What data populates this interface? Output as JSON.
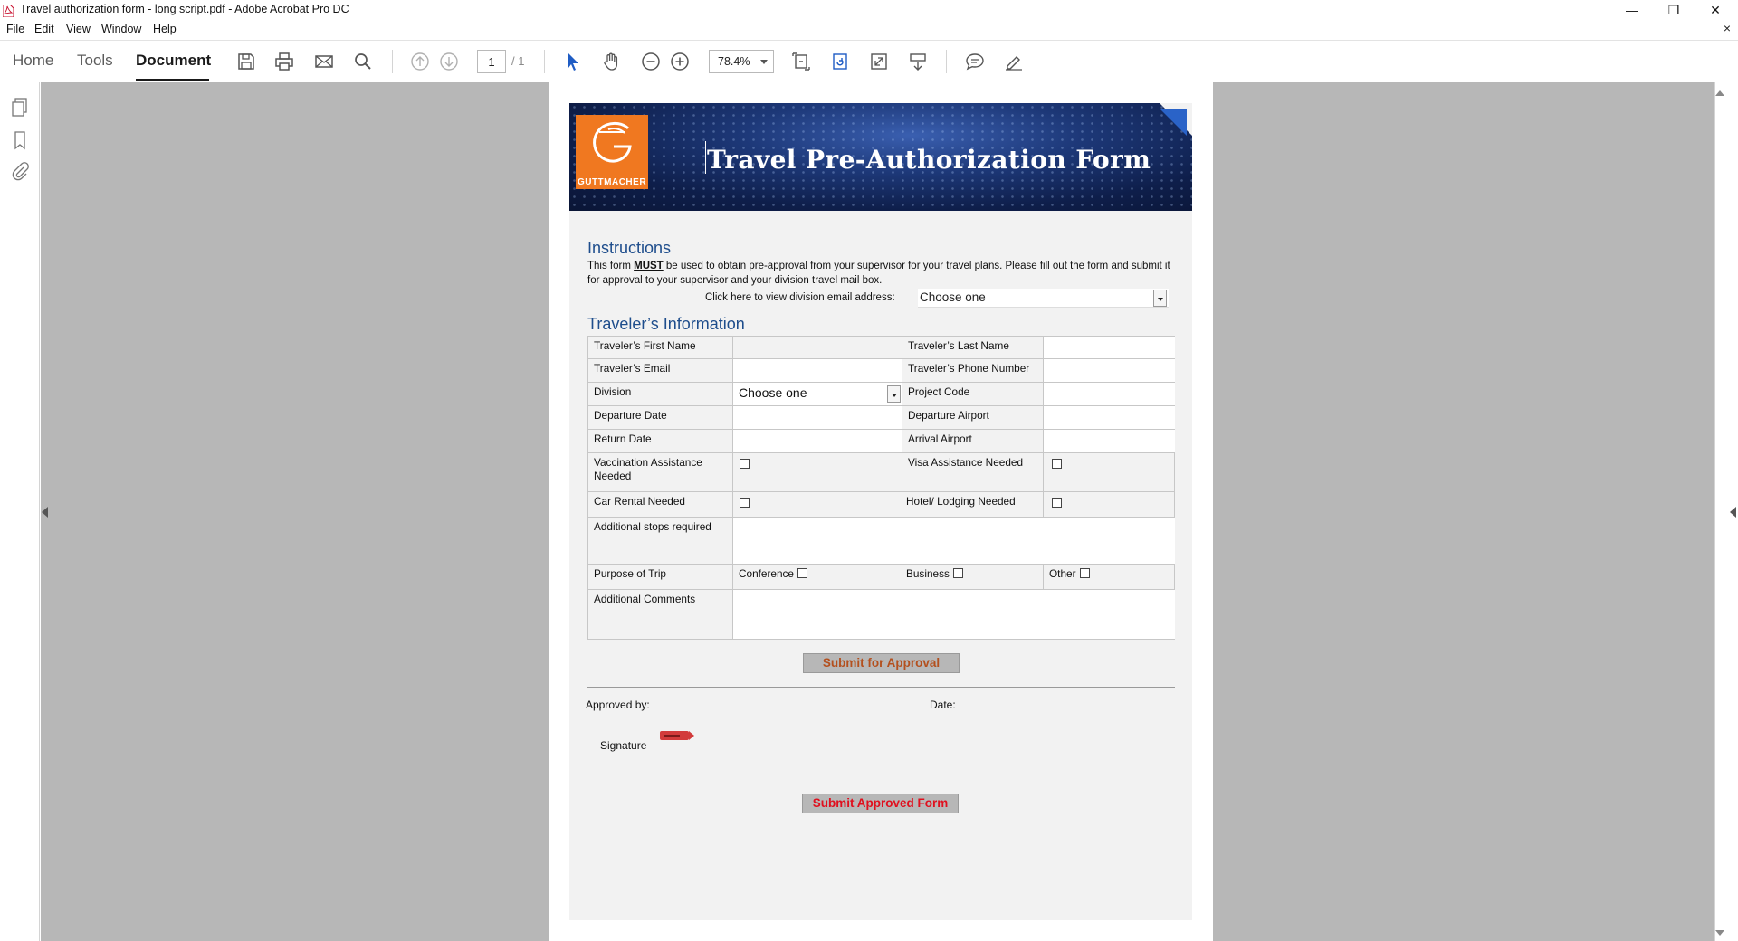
{
  "window": {
    "title": "Travel authorization form - long script.pdf - Adobe Acrobat Pro DC",
    "minimize": "—",
    "maximize": "❐",
    "close": "✕"
  },
  "menu": {
    "items": [
      "File",
      "Edit",
      "View",
      "Window",
      "Help"
    ],
    "doc_close": "×"
  },
  "toolbar": {
    "tabs": [
      "Home",
      "Tools",
      "Document"
    ],
    "page_current": "1",
    "page_total": "/ 1",
    "zoom": "78.4%"
  },
  "form": {
    "logo_text": "GUTTMACHER",
    "title": "Travel Pre-Authorization Form",
    "instructions_heading": "Instructions",
    "instructions_pre": "This form ",
    "instructions_must": "MUST",
    "instructions_post": " be used to obtain pre-approval from your supervisor for your travel plans. Please fill out the form and submit it for approval to your supervisor  and your division travel mail box.",
    "email_label": "Click here to view division email address:",
    "email_select_value": "Choose one",
    "traveler_heading": "Traveler’s Information",
    "fields": {
      "first_name": "Traveler’s First Name",
      "last_name": "Traveler’s Last Name",
      "email": "Traveler’s Email",
      "phone": "Traveler’s Phone Number",
      "division": "Division",
      "division_value": "Choose one",
      "project_code": "Project Code",
      "departure_date": "Departure Date",
      "departure_airport": "Departure Airport",
      "return_date": "Return Date",
      "arrival_airport": "Arrival Airport",
      "vaccination": "Vaccination Assistance Needed",
      "visa": "Visa Assistance Needed",
      "car_rental": "Car Rental Needed",
      "hotel": "Hotel/ Lodging Needed",
      "additional_stops": "Additional stops required",
      "purpose": "Purpose of Trip",
      "conference": "Conference",
      "business": "Business",
      "other": "Other",
      "comments": "Additional Comments"
    },
    "submit_approval": "Submit for Approval",
    "approved_by": "Approved by:",
    "date": "Date:",
    "signature": "Signature",
    "submit_approved": "Submit Approved Form"
  },
  "colors": {
    "heading_blue": "#1e4d8c",
    "submit_approval_text": "#b4501e",
    "submit_approved_text": "#e0101e",
    "logo_orange": "#f07820"
  }
}
